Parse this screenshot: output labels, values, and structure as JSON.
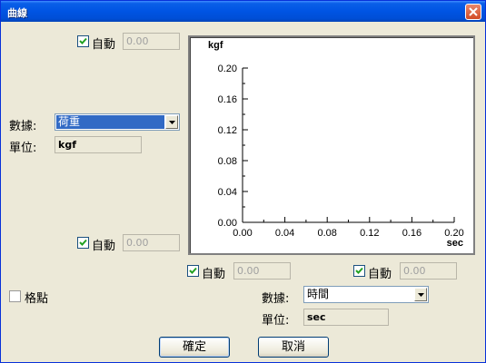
{
  "window": {
    "title": "曲線"
  },
  "top_auto": {
    "label": "自動",
    "value": "0.00",
    "checked": true
  },
  "bottom_auto": {
    "label": "自動",
    "value": "0.00",
    "checked": true
  },
  "x_left_auto": {
    "label": "自動",
    "value": "0.00",
    "checked": true
  },
  "x_right_auto": {
    "label": "自動",
    "value": "0.00",
    "checked": true
  },
  "y_axis": {
    "data_label": "數據:",
    "data_value": "荷重",
    "unit_label": "單位:",
    "unit_value": "kgf"
  },
  "x_axis": {
    "data_label": "數據:",
    "data_value": "時間",
    "unit_label": "單位:",
    "unit_value": "sec"
  },
  "grid": {
    "label": "格點",
    "checked": false
  },
  "buttons": {
    "ok": "確定",
    "cancel": "取消"
  },
  "chart_data": {
    "type": "line",
    "ylabel": "kgf",
    "xlabel": "sec",
    "xlim": [
      0,
      0.2
    ],
    "ylim": [
      0,
      0.2
    ],
    "x_ticks": [
      "0.00",
      "0.04",
      "0.08",
      "0.12",
      "0.16",
      "0.20"
    ],
    "y_ticks": [
      "0.00",
      "0.04",
      "0.08",
      "0.12",
      "0.16",
      "0.20"
    ],
    "x_minor_per_major": 2,
    "y_minor_per_major": 2,
    "series": [],
    "grid": false
  }
}
